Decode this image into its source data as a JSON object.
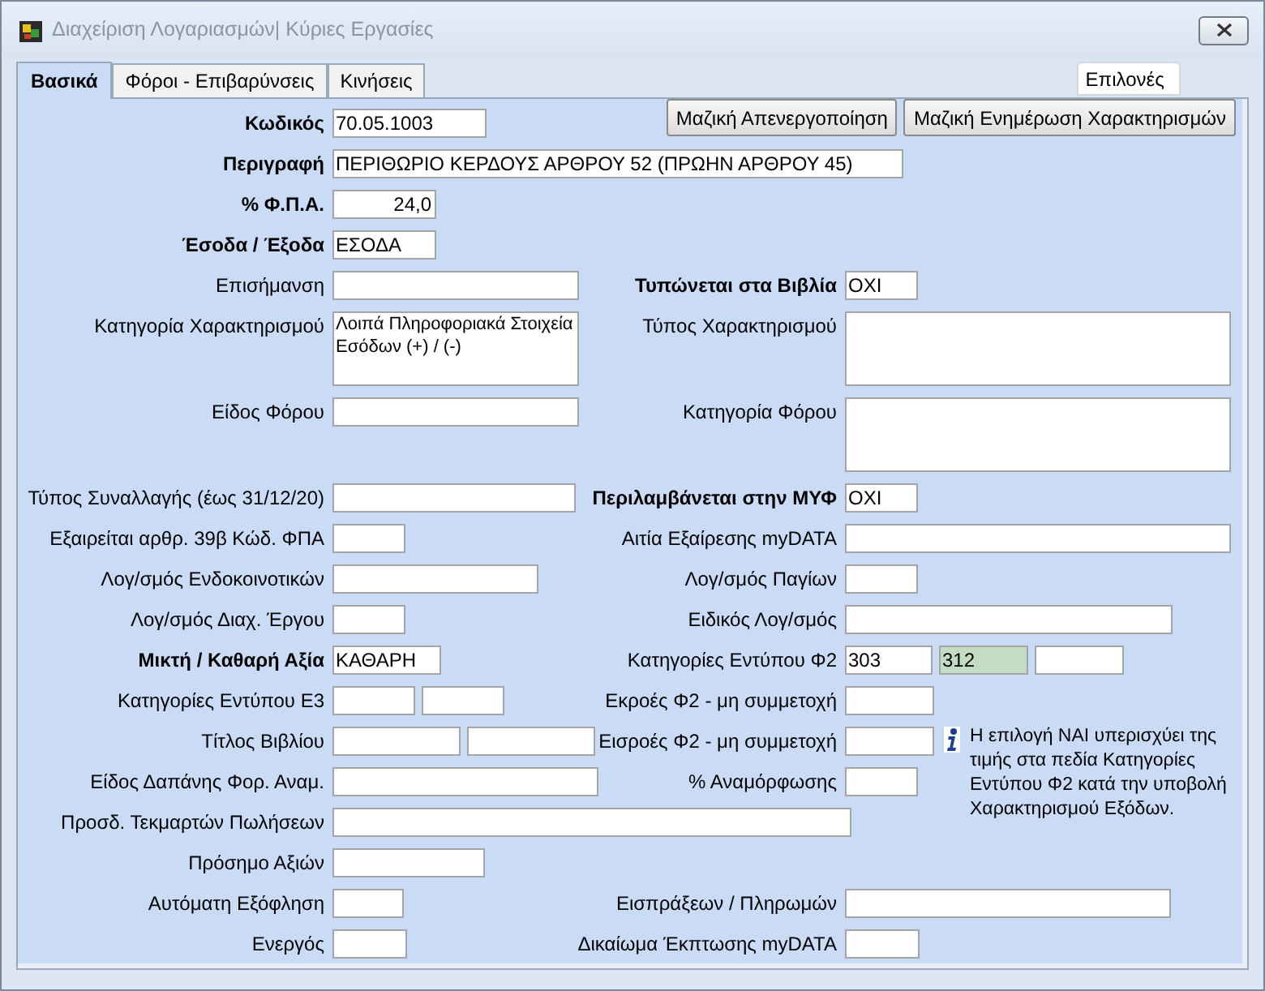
{
  "window": {
    "title": "Διαχείριση Λογαριασμών| Κύριες Εργασίες"
  },
  "tabs": [
    {
      "label": "Βασικά",
      "selected": true
    },
    {
      "label": "Φόροι - Επιβαρύνσεις",
      "selected": false
    },
    {
      "label": "Κινήσεις",
      "selected": false
    }
  ],
  "options_button": "Επιλονές",
  "action_buttons": [
    "Μαζική Απενεργοποίηση",
    "Μαζική Ενημέρωση Χαρακτηρισμών"
  ],
  "rows": [
    {
      "left": {
        "label": "Κωδικός",
        "bold": true,
        "fields": [
          {
            "kind": "text",
            "value": "70.05.1003",
            "highlighted": false
          }
        ]
      }
    },
    {
      "left": {
        "label": "Περιγραφή",
        "bold": true,
        "fields": [
          {
            "kind": "text",
            "value": "ΠΕΡΙΘΩΡΙΟ ΚΕΡΔΟΥΣ ΑΡΘΡΟΥ 52 (ΠΡΩΗΝ ΑΡΘΡΟΥ 45)",
            "highlighted": false
          }
        ]
      }
    },
    {
      "left": {
        "label": "% Φ.Π.Α.",
        "bold": true,
        "fields": [
          {
            "kind": "number",
            "value": "24,0",
            "highlighted": false
          }
        ]
      }
    },
    {
      "left": {
        "label": "Έσοδα / Έξοδα",
        "bold": true,
        "fields": [
          {
            "kind": "text",
            "value": "ΕΣΟΔΑ",
            "highlighted": false
          }
        ]
      }
    },
    {
      "left": {
        "label": "Επισήμανση",
        "bold": false,
        "fields": [
          {
            "kind": "text",
            "highlighted": false
          }
        ]
      },
      "right": {
        "label": "Τυπώνεται στα Βιβλία",
        "bold": true,
        "fields": [
          {
            "kind": "text",
            "value": "OXI",
            "highlighted": false
          }
        ]
      }
    },
    {
      "left": {
        "label": "Κατηγορία Χαρακτηρισμού",
        "bold": false,
        "fields": [
          {
            "kind": "multiline",
            "value": "Λοιπά Πληροφοριακά Στοιχεία Εσόδων (+) / (-)",
            "highlighted": false
          }
        ]
      },
      "right": {
        "label": "Τύπος Χαρακτηρισμού",
        "bold": false,
        "fields": [
          {
            "kind": "multiline",
            "highlighted": false
          }
        ]
      }
    },
    {
      "left": {
        "label": "Είδος Φόρου",
        "bold": false,
        "fields": [
          {
            "kind": "text",
            "highlighted": false
          }
        ]
      },
      "right": {
        "label": "Κατηγορία Φόρου",
        "bold": false,
        "fields": [
          {
            "kind": "multiline",
            "highlighted": false
          }
        ]
      }
    },
    {
      "left": {
        "label": "Τύπος Συναλλαγής (έως 31/12/20)",
        "bold": false,
        "fields": [
          {
            "kind": "text",
            "highlighted": false
          }
        ]
      },
      "right": {
        "label": "Περιλαμβάνεται στην ΜΥΦ",
        "bold": true,
        "fields": [
          {
            "kind": "text",
            "value": "OXI",
            "highlighted": false
          }
        ]
      }
    },
    {
      "left": {
        "label": "Εξαιρείται αρθρ. 39β Κώδ. ΦΠΑ",
        "bold": false,
        "fields": [
          {
            "kind": "text",
            "highlighted": false
          }
        ]
      },
      "right": {
        "label": "Αιτία Εξαίρεσης myDATA",
        "bold": false,
        "fields": [
          {
            "kind": "text",
            "highlighted": false
          }
        ]
      }
    },
    {
      "left": {
        "label": "Λογ/σμός Ενδοκοινοτικών",
        "bold": false,
        "fields": [
          {
            "kind": "text",
            "highlighted": false
          }
        ]
      },
      "right": {
        "label": "Λογ/σμός  Παγίων",
        "bold": false,
        "fields": [
          {
            "kind": "text",
            "highlighted": false
          }
        ]
      }
    },
    {
      "left": {
        "label": "Λογ/σμός Διαχ. Έργου",
        "bold": false,
        "fields": [
          {
            "kind": "text",
            "highlighted": false
          }
        ]
      },
      "right": {
        "label": "Ειδικός Λογ/σμός",
        "bold": false,
        "fields": [
          {
            "kind": "text",
            "highlighted": false
          }
        ]
      }
    },
    {
      "left": {
        "label": "Μικτή  / Καθαρή Αξία",
        "bold": true,
        "fields": [
          {
            "kind": "text",
            "value": "ΚΑΘΑΡΗ",
            "highlighted": false
          }
        ]
      },
      "right": {
        "label": "Κατηγορίες Εντύπου Φ2",
        "bold": false,
        "fields": [
          {
            "kind": "text",
            "value": "303",
            "highlighted": false
          },
          {
            "kind": "text",
            "value": "312",
            "highlighted": true
          },
          {
            "kind": "text",
            "highlighted": false
          }
        ]
      }
    },
    {
      "left": {
        "label": "Κατηγορίες Εντύπου Ε3",
        "bold": false,
        "fields": [
          {
            "kind": "text",
            "highlighted": false
          },
          {
            "kind": "text",
            "highlighted": false
          }
        ]
      },
      "right": {
        "label": "Εκροές Φ2 - μη συμμετοχή",
        "bold": false,
        "fields": [
          {
            "kind": "text",
            "highlighted": false
          }
        ]
      }
    },
    {
      "left": {
        "label": "Τίτλος Βιβλίου",
        "bold": false,
        "fields": [
          {
            "kind": "text",
            "highlighted": false
          },
          {
            "kind": "text",
            "highlighted": false
          }
        ]
      },
      "right": {
        "label": "Εισροές Φ2 - μη συμμετοχή",
        "bold": false,
        "fields": [
          {
            "kind": "text",
            "highlighted": false
          }
        ],
        "note": "Η επιλογή ΝΑΙ υπερισχύει της τιμής στα πεδία Κατηγορίες Εντύπου Φ2 κατά την υποβολή Χαρακτηρισμού Εξόδων."
      }
    },
    {
      "left": {
        "label": "Είδος Δαπάνης Φορ. Αναμ.",
        "bold": false,
        "fields": [
          {
            "kind": "text",
            "highlighted": false
          }
        ]
      },
      "right": {
        "label": "% Αναμόρφωσης",
        "bold": false,
        "fields": [
          {
            "kind": "text",
            "highlighted": false
          }
        ]
      }
    },
    {
      "left": {
        "label": "Προσδ. Τεκμαρτών Πωλήσεων",
        "bold": false,
        "fields": [
          {
            "kind": "text",
            "highlighted": false
          }
        ]
      }
    },
    {
      "left": {
        "label": "Πρόσημο Αξιών",
        "bold": false,
        "fields": [
          {
            "kind": "text",
            "highlighted": false
          }
        ]
      }
    },
    {
      "left": {
        "label": "Αυτόματη Εξόφληση",
        "bold": false,
        "fields": [
          {
            "kind": "text",
            "highlighted": false
          }
        ]
      },
      "right": {
        "label": "Εισπράξεων / Πληρωμών",
        "bold": false,
        "fields": [
          {
            "kind": "text",
            "highlighted": false
          }
        ]
      }
    },
    {
      "left": {
        "label": "Ενεργός",
        "bold": false,
        "fields": [
          {
            "kind": "text",
            "highlighted": false
          }
        ]
      },
      "right": {
        "label": "Δικαίωμα Έκπτωσης myDATA",
        "bold": false,
        "fields": [
          {
            "kind": "text",
            "highlighted": false
          }
        ]
      }
    }
  ]
}
